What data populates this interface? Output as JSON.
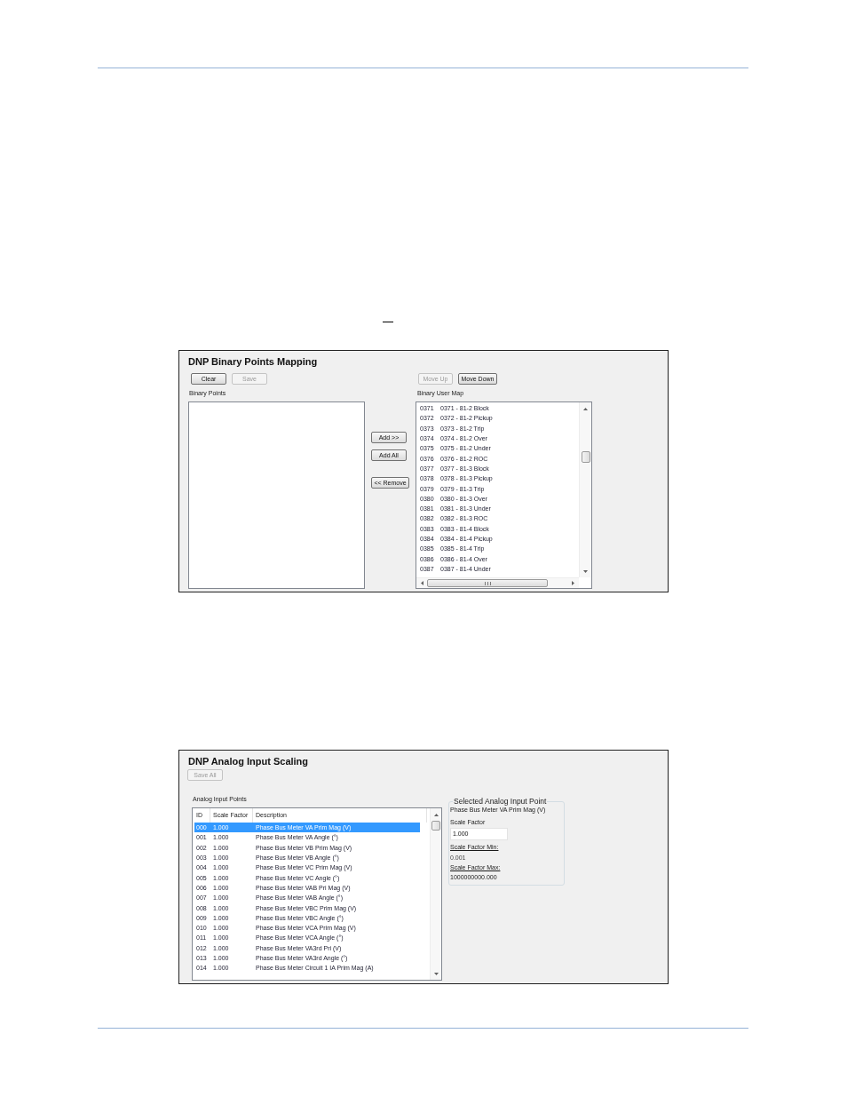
{
  "binary_mapping": {
    "title": "DNP Binary Points Mapping",
    "left_buttons": [
      {
        "label": "Clear",
        "disabled": false
      },
      {
        "label": "Save",
        "disabled": true
      }
    ],
    "right_buttons": [
      {
        "label": "Move Up",
        "disabled": true
      },
      {
        "label": "Move Down",
        "disabled": false
      }
    ],
    "binary_points": {
      "label": "Binary Points"
    },
    "transfer_buttons": [
      {
        "label": "Add >>",
        "disabled": false
      },
      {
        "label": "Add All",
        "disabled": false
      },
      {
        "label": "<< Remove",
        "disabled": false
      }
    ],
    "user_map": {
      "label": "Binary User Map",
      "items": [
        {
          "number": "0371",
          "name": "0371 - 81-2 Block"
        },
        {
          "number": "0372",
          "name": "0372 - 81-2 Pickup"
        },
        {
          "number": "0373",
          "name": "0373 - 81-2 Trip"
        },
        {
          "number": "0374",
          "name": "0374 - 81-2 Over"
        },
        {
          "number": "0375",
          "name": "0375 - 81-2 Under"
        },
        {
          "number": "0376",
          "name": "0376 - 81-2 ROC"
        },
        {
          "number": "0377",
          "name": "0377 - 81-3 Block"
        },
        {
          "number": "0378",
          "name": "0378 - 81-3 Pickup"
        },
        {
          "number": "0379",
          "name": "0379 - 81-3 Trip"
        },
        {
          "number": "0380",
          "name": "0380 - 81-3 Over"
        },
        {
          "number": "0381",
          "name": "0381 - 81-3 Under"
        },
        {
          "number": "0382",
          "name": "0382 - 81-3 ROC"
        },
        {
          "number": "0383",
          "name": "0383 - 81-4 Block"
        },
        {
          "number": "0384",
          "name": "0384 - 81-4 Pickup"
        },
        {
          "number": "0385",
          "name": "0385 - 81-4 Trip"
        },
        {
          "number": "0386",
          "name": "0386 - 81-4 Over"
        },
        {
          "number": "0387",
          "name": "0387 - 81-4 Under"
        }
      ]
    }
  },
  "analog_scaling": {
    "title": "DNP Analog Input Scaling",
    "save_all": {
      "label": "Save All",
      "disabled": true
    },
    "points": {
      "label": "Analog Input Points",
      "columns": [
        "ID",
        "Scale Factor",
        "Description"
      ],
      "rows": [
        {
          "id": "000",
          "scale_factor": "1.000",
          "description": "Phase Bus Meter VA Prim Mag (V)",
          "selected": true
        },
        {
          "id": "001",
          "scale_factor": "1.000",
          "description": "Phase Bus Meter VA Angle (°)",
          "selected": false
        },
        {
          "id": "002",
          "scale_factor": "1.000",
          "description": "Phase Bus Meter VB Prim Mag (V)",
          "selected": false
        },
        {
          "id": "003",
          "scale_factor": "1.000",
          "description": "Phase Bus Meter VB Angle (°)",
          "selected": false
        },
        {
          "id": "004",
          "scale_factor": "1.000",
          "description": "Phase Bus Meter VC Prim Mag (V)",
          "selected": false
        },
        {
          "id": "005",
          "scale_factor": "1.000",
          "description": "Phase Bus Meter VC Angle (°)",
          "selected": false
        },
        {
          "id": "006",
          "scale_factor": "1.000",
          "description": "Phase Bus Meter VAB Pri Mag (V)",
          "selected": false
        },
        {
          "id": "007",
          "scale_factor": "1.000",
          "description": "Phase Bus Meter VAB Angle (°)",
          "selected": false
        },
        {
          "id": "008",
          "scale_factor": "1.000",
          "description": "Phase Bus Meter VBC Prim Mag (V)",
          "selected": false
        },
        {
          "id": "009",
          "scale_factor": "1.000",
          "description": "Phase Bus Meter VBC Angle (°)",
          "selected": false
        },
        {
          "id": "010",
          "scale_factor": "1.000",
          "description": "Phase Bus Meter VCA Prim Mag (V)",
          "selected": false
        },
        {
          "id": "011",
          "scale_factor": "1.000",
          "description": "Phase Bus Meter VCA Angle (°)",
          "selected": false
        },
        {
          "id": "012",
          "scale_factor": "1.000",
          "description": "Phase Bus Meter VA3rd Pri (V)",
          "selected": false
        },
        {
          "id": "013",
          "scale_factor": "1.000",
          "description": "Phase Bus Meter VA3rd Angle (°)",
          "selected": false
        },
        {
          "id": "014",
          "scale_factor": "1.000",
          "description": "Phase Bus Meter Circuit 1 IA Prim Mag (A)",
          "selected": false
        }
      ]
    },
    "selected_point": {
      "legend": "Selected Analog Input Point",
      "description": "Phase Bus Meter VA Prim Mag (V)",
      "scale_factor_label": "Scale Factor",
      "scale_factor_value": "1.000",
      "min_label": "Scale Factor Min:",
      "min_value": "0.001",
      "max_label": "Scale Factor Max:",
      "max_value": "1000000000.000"
    }
  }
}
